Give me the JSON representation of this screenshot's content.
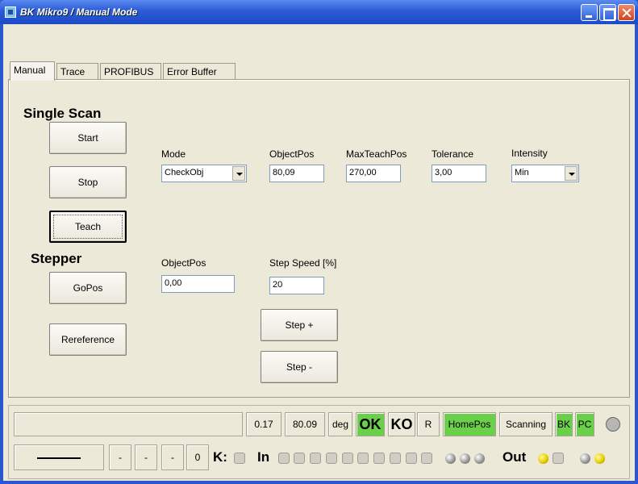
{
  "window": {
    "title": "BK Mikro9 / Manual Mode"
  },
  "tabs": [
    {
      "label": "Manual"
    },
    {
      "label": "Trace"
    },
    {
      "label": "PROFIBUS"
    },
    {
      "label": "Error Buffer"
    }
  ],
  "single_scan": {
    "heading": "Single Scan",
    "start_label": "Start",
    "stop_label": "Stop",
    "teach_label": "Teach"
  },
  "params": {
    "mode": {
      "label": "Mode",
      "value": "CheckObj"
    },
    "object_pos": {
      "label": "ObjectPos",
      "value": "80,09"
    },
    "max_teach_pos": {
      "label": "MaxTeachPos",
      "value": "270,00"
    },
    "tolerance": {
      "label": "Tolerance",
      "value": "3,00"
    },
    "intensity": {
      "label": "Intensity",
      "value": "Min"
    }
  },
  "stepper": {
    "heading": "Stepper",
    "gopos_label": "GoPos",
    "reference_label": "Rereference",
    "object_pos": {
      "label": "ObjectPos",
      "value": "0,00"
    },
    "step_speed": {
      "label": "Step Speed [%]",
      "value": "20"
    },
    "step_plus_label": "Step +",
    "step_minus_label": "Step -"
  },
  "status": {
    "value1": "0.17",
    "value2": "80.09",
    "unit": "deg",
    "ok": "OK",
    "ko": "KO",
    "r": "R",
    "homepos": "HomePos",
    "scanning": "Scanning",
    "bk": "BK",
    "pc": "PC",
    "dash1": "-",
    "dash2": "-",
    "dash3": "-",
    "zero": "0",
    "k_label": "K:",
    "in_label": "In",
    "out_label": "Out",
    "status_green": "#6ad04a",
    "led_yellow": "#e8d000"
  }
}
